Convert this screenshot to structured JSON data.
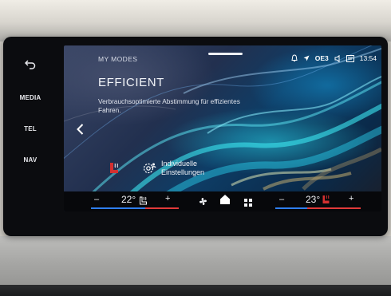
{
  "side_keys": [
    {
      "label": "",
      "icon": "back-arrow-icon"
    },
    {
      "label": "MEDIA"
    },
    {
      "label": "TEL"
    },
    {
      "label": "NAV"
    }
  ],
  "header": {
    "section_title": "MY MODES"
  },
  "status": {
    "signal_label": "OE3",
    "time": "13:54"
  },
  "mode": {
    "title": "EFFICIENT",
    "description": "Verbrauchsoptimierte Abstimmung für effizientes Fahren."
  },
  "individual_button": {
    "label": "Individuelle\nEinstellungen"
  },
  "climate": {
    "left": {
      "minus": "–",
      "temp": "22°",
      "plus": "+"
    },
    "right": {
      "minus": "–",
      "temp": "23°",
      "plus": "+"
    }
  },
  "colors": {
    "accent_blue": "#2f7ff0",
    "accent_red": "#e23a3a",
    "seat_heat_red": "#d43030"
  }
}
